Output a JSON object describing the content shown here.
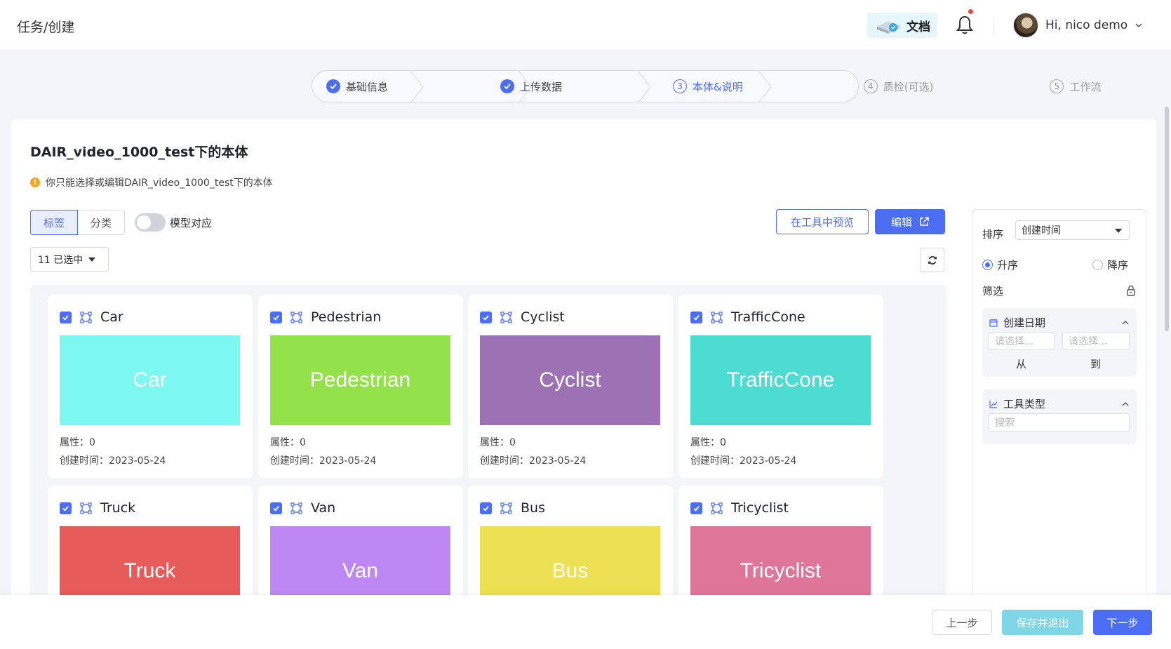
{
  "header": {
    "breadcrumb": [
      "任务",
      "创建"
    ],
    "breadcrumb_sep": "/",
    "docs_label": "文档",
    "greeting": "Hi, nico demo"
  },
  "steps": [
    {
      "label": "基础信息",
      "state": "done"
    },
    {
      "label": "上传数据",
      "state": "done"
    },
    {
      "label": "本体&说明",
      "state": "active",
      "num": "3"
    },
    {
      "label": "质检(可选)",
      "state": "todo",
      "num": "4"
    },
    {
      "label": "工作流",
      "state": "todo",
      "num": "5"
    }
  ],
  "panel": {
    "title": "DAIR_video_1000_test下的本体",
    "tip": "你只能选择或编辑DAIR_video_1000_test下的本体",
    "tip_icon": "!",
    "tabs": [
      "标签",
      "分类"
    ],
    "toggle_label": "模型对应",
    "preview_label": "在工具中预览",
    "edit_label": "编辑",
    "selected_label": "11 已选中"
  },
  "cards": [
    {
      "name": "Car",
      "color": "#7cf8f0",
      "attr": "属性：0",
      "date": "创建时间：2023-05-24"
    },
    {
      "name": "Pedestrian",
      "color": "#93e24a",
      "attr": "属性：0",
      "date": "创建时间：2023-05-24"
    },
    {
      "name": "Cyclist",
      "color": "#9c72b4",
      "attr": "属性：0",
      "date": "创建时间：2023-05-24"
    },
    {
      "name": "TrafficCone",
      "color": "#4cdcd2",
      "attr": "属性：0",
      "date": "创建时间：2023-05-24"
    },
    {
      "name": "Truck",
      "color": "#e85b5b",
      "attr": "",
      "date": ""
    },
    {
      "name": "Van",
      "color": "#bd88f3",
      "attr": "",
      "date": ""
    },
    {
      "name": "Bus",
      "color": "#ede052",
      "attr": "",
      "date": ""
    },
    {
      "name": "Tricyclist",
      "color": "#df7599",
      "attr": "",
      "date": ""
    }
  ],
  "side": {
    "sort_label": "排序",
    "sort_value": "创建时间",
    "asc_label": "升序",
    "desc_label": "降序",
    "filter_label": "筛选",
    "date_label": "创建日期",
    "date_from_placeholder": "请选择...",
    "date_to_placeholder": "请选择...",
    "from_label": "从",
    "to_label": "到",
    "tool_label": "工具类型",
    "search_placeholder": "搜索"
  },
  "footer": {
    "prev_label": "上一步",
    "save_label": "保存并退出",
    "next_label": "下一步"
  }
}
